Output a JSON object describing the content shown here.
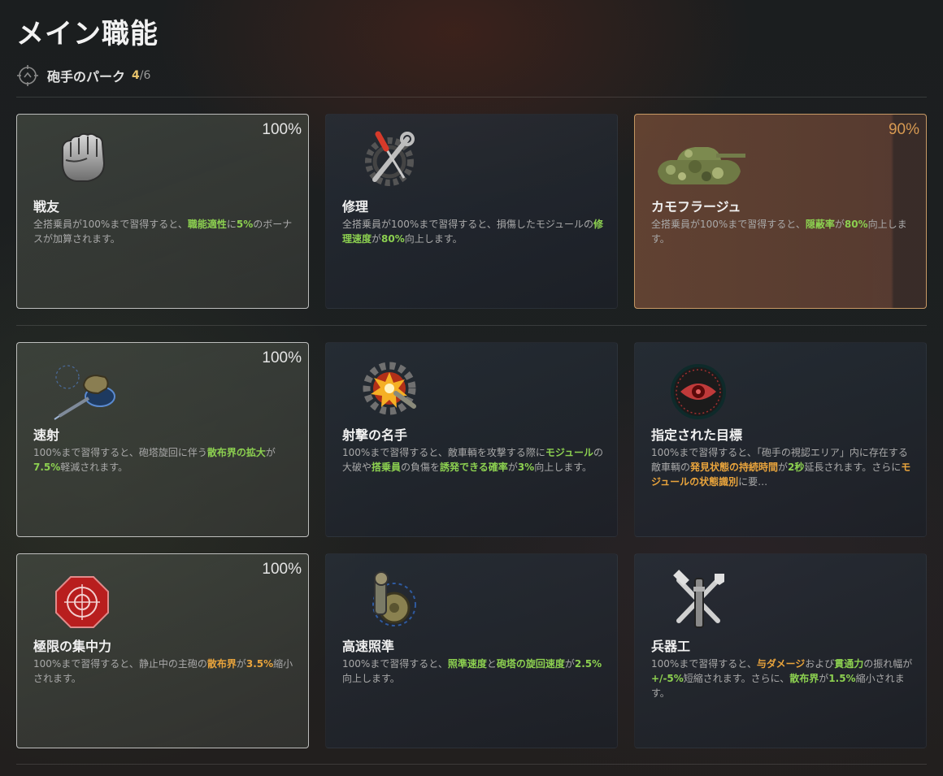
{
  "page": {
    "title": "メイン職能"
  },
  "section": {
    "label": "砲手のパーク",
    "count_current": "4",
    "count_separator": "/",
    "count_total": "6"
  },
  "colors": {
    "highlight_green": "#8cd050",
    "highlight_orange": "#e9a43c",
    "percent_partial": "#d79a52",
    "count_current": "#e8c36c"
  },
  "perks": [
    {
      "name": "戦友",
      "icon": "fist-icon",
      "percent": "100%",
      "state": "learned",
      "desc": [
        {
          "t": "全搭乗員が100%まで習得すると、"
        },
        {
          "t": "職能適性",
          "hl": "green"
        },
        {
          "t": "に"
        },
        {
          "t": "5%",
          "hl": "green"
        },
        {
          "t": "のボーナスが加算されます。"
        }
      ]
    },
    {
      "name": "修理",
      "icon": "repair-tools-icon",
      "percent": "",
      "state": "none",
      "desc": [
        {
          "t": "全搭乗員が100%まで習得すると、損傷したモジュールの"
        },
        {
          "t": "修理速度",
          "hl": "green"
        },
        {
          "t": "が"
        },
        {
          "t": "80%",
          "hl": "green"
        },
        {
          "t": "向上します。"
        }
      ]
    },
    {
      "name": "カモフラージュ",
      "icon": "camo-tank-icon",
      "percent": "90%",
      "state": "partial",
      "desc": [
        {
          "t": "全搭乗員が100%まで習得すると、"
        },
        {
          "t": "隠蔽率",
          "hl": "green"
        },
        {
          "t": "が"
        },
        {
          "t": "80%",
          "hl": "green"
        },
        {
          "t": "向上します。"
        }
      ]
    },
    {
      "name": "速射",
      "icon": "turret-rotation-icon",
      "percent": "100%",
      "state": "learned",
      "desc": [
        {
          "t": "100%まで習得すると、砲塔旋回に伴う"
        },
        {
          "t": "散布界の拡大",
          "hl": "green"
        },
        {
          "t": "が"
        },
        {
          "t": "7.5%",
          "hl": "green"
        },
        {
          "t": "軽減されます。"
        }
      ]
    },
    {
      "name": "射撃の名手",
      "icon": "explosion-gear-icon",
      "percent": "",
      "state": "none",
      "desc": [
        {
          "t": "100%まで習得すると、敵車輌を攻撃する際に"
        },
        {
          "t": "モジュール",
          "hl": "green"
        },
        {
          "t": "の大破や"
        },
        {
          "t": "搭乗員",
          "hl": "green"
        },
        {
          "t": "の負傷を"
        },
        {
          "t": "誘発できる確率",
          "hl": "green"
        },
        {
          "t": "が"
        },
        {
          "t": "3%",
          "hl": "green"
        },
        {
          "t": "向上します。"
        }
      ]
    },
    {
      "name": "指定された目標",
      "icon": "red-eye-icon",
      "percent": "",
      "state": "none",
      "desc": [
        {
          "t": "100%まで習得すると、「砲手の視認エリア」内に存在する敵車輌の"
        },
        {
          "t": "発見状態の持続時間",
          "hl": "orange"
        },
        {
          "t": "が"
        },
        {
          "t": "2秒",
          "hl": "green"
        },
        {
          "t": "延長されます。さらに"
        },
        {
          "t": "モジュールの状態識別",
          "hl": "orange"
        },
        {
          "t": "に要…"
        }
      ]
    },
    {
      "name": "極限の集中力",
      "icon": "target-octagon-icon",
      "percent": "100%",
      "state": "learned",
      "desc": [
        {
          "t": "100%まで習得すると、静止中の主砲の"
        },
        {
          "t": "散布界",
          "hl": "orange"
        },
        {
          "t": "が"
        },
        {
          "t": "3.5%",
          "hl": "orange"
        },
        {
          "t": "縮小されます。"
        }
      ]
    },
    {
      "name": "高速照準",
      "icon": "traverse-gear-icon",
      "percent": "",
      "state": "none",
      "desc": [
        {
          "t": "100%まで習得すると、"
        },
        {
          "t": "照準速度",
          "hl": "green"
        },
        {
          "t": "と"
        },
        {
          "t": "砲塔の旋回速度",
          "hl": "green"
        },
        {
          "t": "が"
        },
        {
          "t": "2.5%",
          "hl": "green"
        },
        {
          "t": "向上します。"
        }
      ]
    },
    {
      "name": "兵器工",
      "icon": "ordnance-tools-icon",
      "percent": "",
      "state": "none",
      "desc": [
        {
          "t": "100%まで習得すると、"
        },
        {
          "t": "与ダメージ",
          "hl": "orange"
        },
        {
          "t": "および"
        },
        {
          "t": "貫通力",
          "hl": "green"
        },
        {
          "t": "の振れ幅が"
        },
        {
          "t": "+/-5%",
          "hl": "green"
        },
        {
          "t": "短縮されます。さらに、"
        },
        {
          "t": "散布界",
          "hl": "green"
        },
        {
          "t": "が"
        },
        {
          "t": "1.5%",
          "hl": "green"
        },
        {
          "t": "縮小されます。"
        }
      ]
    }
  ]
}
